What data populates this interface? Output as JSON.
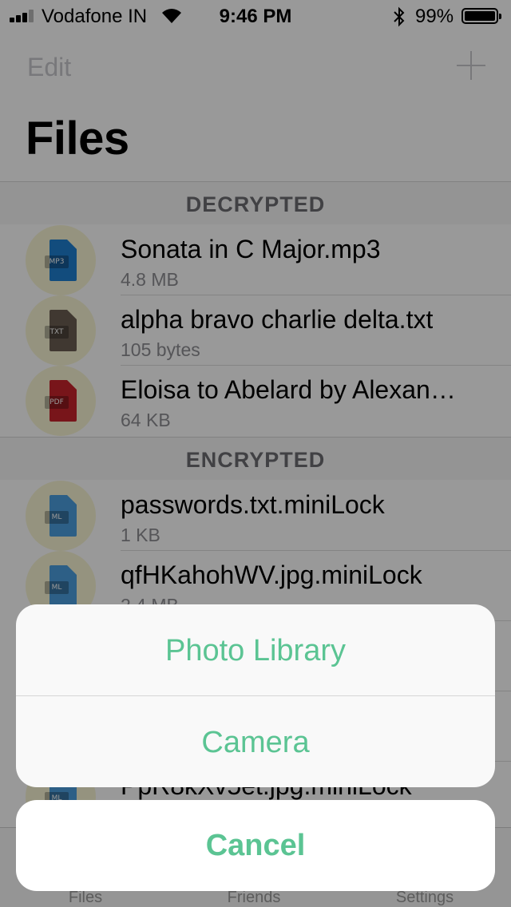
{
  "status_bar": {
    "carrier": "Vodafone IN",
    "time": "9:46 PM",
    "battery": "99%"
  },
  "nav": {
    "edit_label": "Edit",
    "title": "Files"
  },
  "sections": [
    {
      "header": "DECRYPTED",
      "files": [
        {
          "name": "Sonata in C Major.mp3",
          "size": "4.8 MB",
          "type": "MP3",
          "color": "#1f7fd1"
        },
        {
          "name": "alpha bravo charlie  delta.txt",
          "size": "105 bytes",
          "type": "TXT",
          "color": "#6b5e52"
        },
        {
          "name": "Eloisa to Abelard by Alexan…",
          "size": "64 KB",
          "type": "PDF",
          "color": "#c8242c"
        }
      ]
    },
    {
      "header": "ENCRYPTED",
      "files": [
        {
          "name": "passwords.txt.miniLock",
          "size": "1 KB",
          "type": "ML",
          "color": "#4b9fe0"
        },
        {
          "name": "qfHKahohWV.jpg.miniLock",
          "size": "2.4 MB",
          "type": "ML",
          "color": "#4b9fe0"
        },
        {
          "name": "",
          "size": "",
          "type": "ML",
          "color": "#4b9fe0"
        },
        {
          "name": "",
          "size": "",
          "type": "ML",
          "color": "#4b9fe0"
        },
        {
          "name": "PpR8kXv5et.jpg.miniLock",
          "size": "",
          "type": "ML",
          "color": "#4b9fe0"
        }
      ]
    }
  ],
  "tabbar": {
    "tabs": [
      "Files",
      "Friends",
      "Settings"
    ]
  },
  "action_sheet": {
    "options": [
      "Photo Library",
      "Camera"
    ],
    "cancel_label": "Cancel"
  },
  "colors": {
    "accent": "#5bc493",
    "avatar_bg": "#f8f6d4"
  }
}
